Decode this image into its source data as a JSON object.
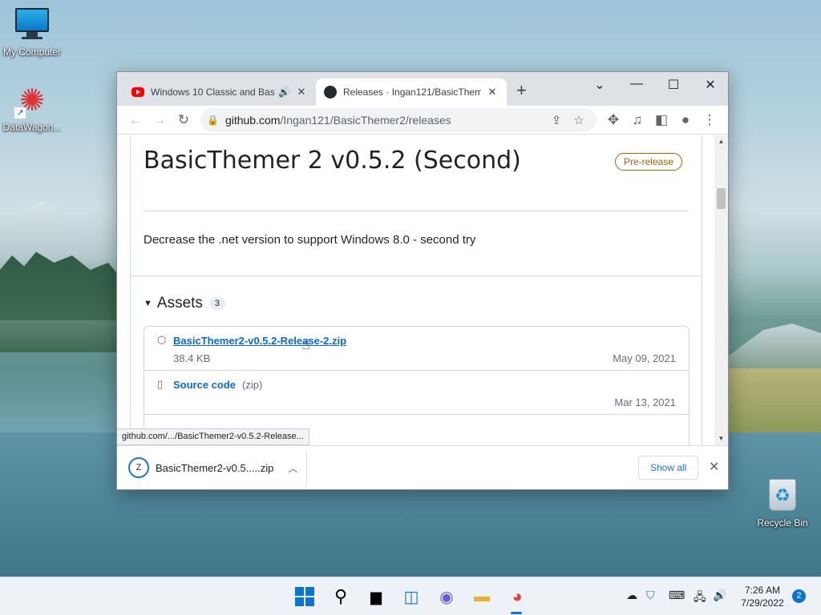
{
  "desktop": {
    "icons": [
      {
        "label": "My Computer"
      },
      {
        "label": "DataWagon..."
      },
      {
        "label": "Recycle Bin"
      }
    ]
  },
  "browser": {
    "tabs": [
      {
        "title": "Windows 10 Classic and Basi",
        "favicon": "youtube-icon",
        "audio": true,
        "active": false
      },
      {
        "title": "Releases · Ingan121/BasicThemer",
        "favicon": "github-icon",
        "active": true
      }
    ],
    "address": {
      "host": "github.com",
      "path": "/Ingan121/BasicThemer2/releases"
    },
    "status_url": "github.com/.../BasicThemer2-v0.5.2-Release...",
    "downloads": {
      "file_name": "BasicThemer2-v0.5.....zip",
      "show_all_label": "Show all"
    }
  },
  "release": {
    "title": "BasicThemer 2 v0.5.2 (Second)",
    "badge": "Pre-release",
    "description": "Decrease the .net version to support Windows 8.0 - second try",
    "assets_heading": "Assets",
    "assets_count": "3",
    "assets": [
      {
        "name": "BasicThemer2-v0.5.2-Release-2.zip",
        "size": "38.4 KB",
        "date": "May 09, 2021",
        "icon": "package-icon"
      },
      {
        "name": "Source code",
        "suffix": "(zip)",
        "date": "Mar 13, 2021",
        "icon": "zip-icon"
      }
    ]
  },
  "taskbar": {
    "time": "7:26 AM",
    "date": "7/29/2022",
    "notifications": "2"
  },
  "colors": {
    "link": "#0969da",
    "prerelease": "#9a6700",
    "accent": "#0a74d6"
  }
}
